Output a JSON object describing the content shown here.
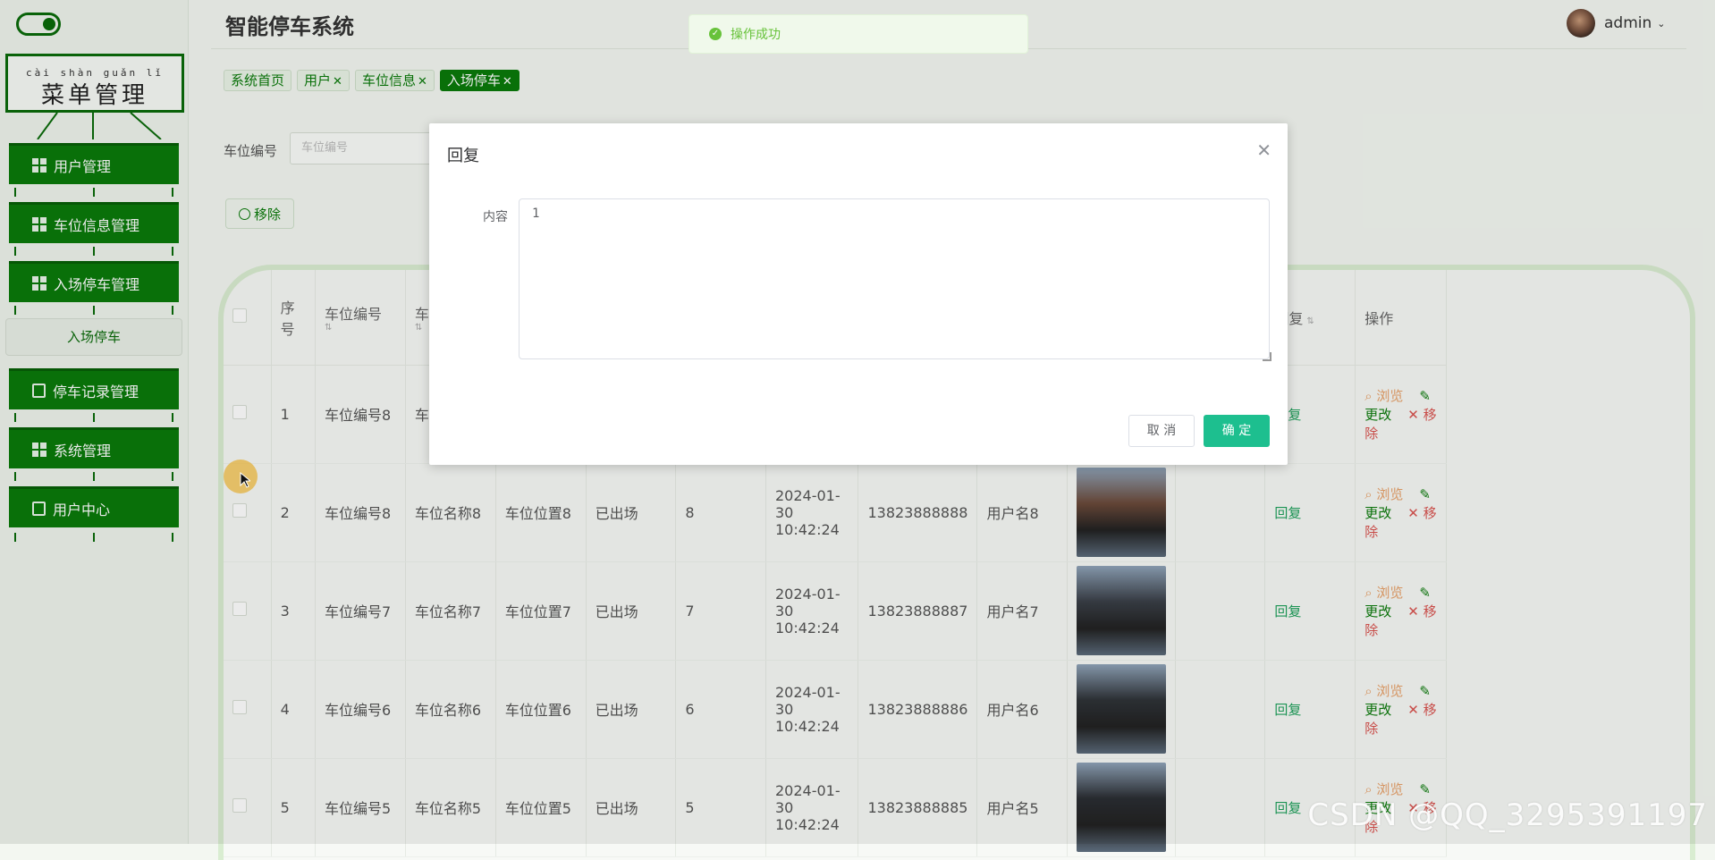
{
  "app": {
    "title": "智能停车系统"
  },
  "user": {
    "name": "admin"
  },
  "sidebar": {
    "menu_title": {
      "pinyin": "cài shàn guǎn lǐ",
      "main": "菜单管理"
    },
    "items": [
      {
        "label": "用户管理"
      },
      {
        "label": "车位信息管理"
      },
      {
        "label": "入场停车管理"
      },
      {
        "label": "停车记录管理"
      },
      {
        "label": "系统管理"
      },
      {
        "label": "用户中心"
      }
    ],
    "submenu": {
      "label": "入场停车"
    }
  },
  "tags": [
    {
      "label": "系统首页",
      "closable": false,
      "active": false
    },
    {
      "label": "用户",
      "closable": true,
      "active": false
    },
    {
      "label": "车位信息",
      "closable": true,
      "active": false
    },
    {
      "label": "入场停车",
      "closable": true,
      "active": true
    }
  ],
  "search": {
    "label": "车位编号",
    "placeholder": "车位编号"
  },
  "toolbar": {
    "remove_label": "移除"
  },
  "table": {
    "headers": {
      "index": "序号",
      "space_no": "车位编号",
      "space_name": "车",
      "reply": "回复",
      "ops": "操作"
    },
    "rows": [
      {
        "index": "1",
        "space_no": "车位编号8",
        "space_name": "车",
        "space_pos": "",
        "status": "",
        "num": "",
        "time": "",
        "phone": "",
        "user": "",
        "has_image": false,
        "reply": "回复"
      },
      {
        "index": "2",
        "space_no": "车位编号8",
        "space_name": "车位名称8",
        "space_pos": "车位位置8",
        "status": "已出场",
        "num": "8",
        "time": "2024-01-30 10:42:24",
        "phone": "13823888888",
        "user": "用户名8",
        "has_image": true,
        "reply": "回复"
      },
      {
        "index": "3",
        "space_no": "车位编号7",
        "space_name": "车位名称7",
        "space_pos": "车位位置7",
        "status": "已出场",
        "num": "7",
        "time": "2024-01-30 10:42:24",
        "phone": "13823888887",
        "user": "用户名7",
        "has_image": true,
        "reply": "回复"
      },
      {
        "index": "4",
        "space_no": "车位编号6",
        "space_name": "车位名称6",
        "space_pos": "车位位置6",
        "status": "已出场",
        "num": "6",
        "time": "2024-01-30 10:42:24",
        "phone": "13823888886",
        "user": "用户名6",
        "has_image": true,
        "reply": "回复"
      },
      {
        "index": "5",
        "space_no": "车位编号5",
        "space_name": "车位名称5",
        "space_pos": "车位位置5",
        "status": "已出场",
        "num": "5",
        "time": "2024-01-30 10:42:24",
        "phone": "13823888885",
        "user": "用户名5",
        "has_image": true,
        "reply": "回复"
      }
    ],
    "ops": {
      "view": "浏览",
      "edit": "更改",
      "del": "移除"
    }
  },
  "modal": {
    "title": "回复",
    "field_label": "内容",
    "field_value": "1",
    "cancel": "取 消",
    "confirm": "确 定"
  },
  "toast": {
    "message": "操作成功"
  },
  "watermark": "CSDN @QQ_3295391197",
  "colors": {
    "primary": "#0a7a0a",
    "confirm": "#1dbf8f",
    "success": "#67c23a",
    "danger": "#d9534f"
  }
}
